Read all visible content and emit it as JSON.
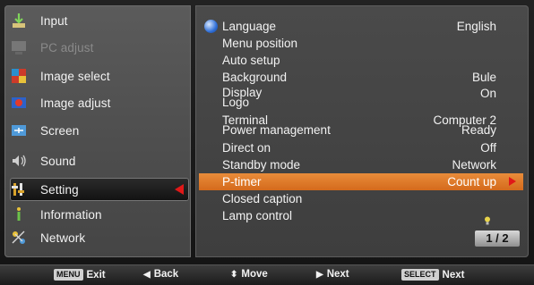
{
  "left_menu": {
    "items": [
      {
        "label": "Input",
        "icon": "input-icon",
        "disabled": false,
        "selected": false
      },
      {
        "label": "PC adjust",
        "icon": "pc-adjust-icon",
        "disabled": true,
        "selected": false
      },
      {
        "label": "Image select",
        "icon": "image-select-icon",
        "disabled": false,
        "selected": false
      },
      {
        "label": "Image adjust",
        "icon": "image-adjust-icon",
        "disabled": false,
        "selected": false
      },
      {
        "label": "Screen",
        "icon": "screen-icon",
        "disabled": false,
        "selected": false
      },
      {
        "label": "Sound",
        "icon": "speaker-icon",
        "disabled": false,
        "selected": false
      },
      {
        "label": "Setting",
        "icon": "setting-icon",
        "disabled": false,
        "selected": true
      },
      {
        "label": "Information",
        "icon": "information-icon",
        "disabled": false,
        "selected": false
      },
      {
        "label": "Network",
        "icon": "network-icon",
        "disabled": false,
        "selected": false
      }
    ]
  },
  "right_menu": {
    "items": [
      {
        "label": "Language",
        "value": "English"
      },
      {
        "label": "Menu position",
        "value": ""
      },
      {
        "label": "Auto setup",
        "value": ""
      },
      {
        "label": "Background",
        "value": "Bule"
      },
      {
        "label": "Display\nLogo",
        "value": "On"
      },
      {
        "label": "Terminal\nPower management",
        "value": "Computer 2\nReady"
      },
      {
        "label": "Direct on",
        "value": "Off"
      },
      {
        "label": "Standby mode",
        "value": "Network"
      },
      {
        "label": "P-timer",
        "value": "Count up"
      },
      {
        "label": "Closed caption",
        "value": ""
      },
      {
        "label": "Lamp control",
        "value": ""
      }
    ],
    "page_indicator": "1 / 2"
  },
  "footer": {
    "exit_key": "MENU",
    "exit_label": "Exit",
    "back_label": "Back",
    "move_label": "Move",
    "next_label": "Next",
    "select_key": "SELECT",
    "select_next_label": "Next"
  },
  "colors": {
    "highlight": "#e07a2b",
    "selected_arrow": "#e01818"
  }
}
